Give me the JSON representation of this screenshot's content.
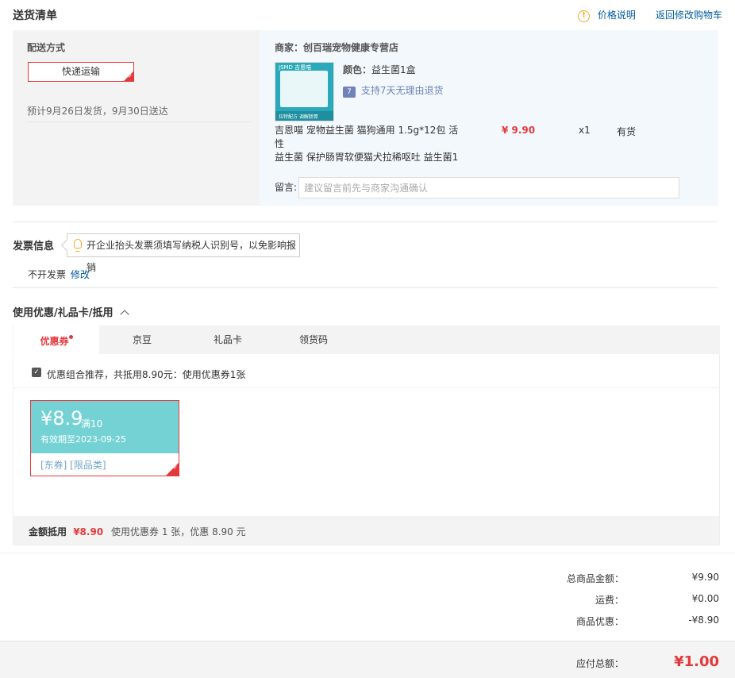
{
  "header": {
    "title": "送货清单",
    "price_note": "价格说明",
    "back_to_cart": "返回修改购物车"
  },
  "shipping": {
    "method_label": "配送方式",
    "method_value": "快递运输",
    "estimate": "预计9月26日发货，9月30日送达"
  },
  "shop": {
    "label": "商家：",
    "name": "创百瑞宠物健康专营店"
  },
  "product": {
    "color_label": "颜色：",
    "color_value": "益生菌1盒",
    "return_badge": "7",
    "return_policy": "支持7天无理由退货",
    "name_line1": "吉恩喵 宠物益生菌 猫狗通用 1.5g*12包 活性",
    "name_line2": "益生菌 保护肠胃软便猫犬拉稀呕吐 益生菌1",
    "price": "¥ 9.90",
    "qty": "x1",
    "stock": "有货",
    "thumb_text_top": "JSMD 吉恩喵",
    "thumb_text_bottom": "拉特配方 调解肠胃"
  },
  "note": {
    "label": "留言:",
    "placeholder": "建议留言前先与商家沟通确认"
  },
  "invoice": {
    "title": "发票信息",
    "tip": "开企业抬头发票须填写纳税人识别号，以免影响报销",
    "status": "不开发票",
    "edit": "修改"
  },
  "coupons": {
    "section_title": "使用优惠/礼品卡/抵用",
    "tabs": [
      "优惠券",
      "京豆",
      "礼品卡",
      "领货码"
    ],
    "combo_text": "优惠组合推荐，共抵用8.90元：使用优惠券1张",
    "card": {
      "amount": "¥8.9",
      "condition": "满10",
      "valid": "有效期至2023-09-25",
      "tags": "[东券] [限品类]"
    },
    "summary_label": "金额抵用",
    "summary_amount": "¥8.90",
    "summary_detail": "使用优惠券 1 张，优惠 8.90 元"
  },
  "totals": {
    "goods_label": "总商品金额：",
    "goods_value": "¥9.90",
    "freight_label": "运费：",
    "freight_value": "¥0.00",
    "discount_label": "商品优惠：",
    "discount_value": "-¥8.90",
    "payable_label": "应付总额：",
    "payable_value": "¥1.00"
  },
  "colors": {
    "accent_red": "#e4393c",
    "link_blue": "#005aa0",
    "coupon_teal": "#74d2d4"
  }
}
